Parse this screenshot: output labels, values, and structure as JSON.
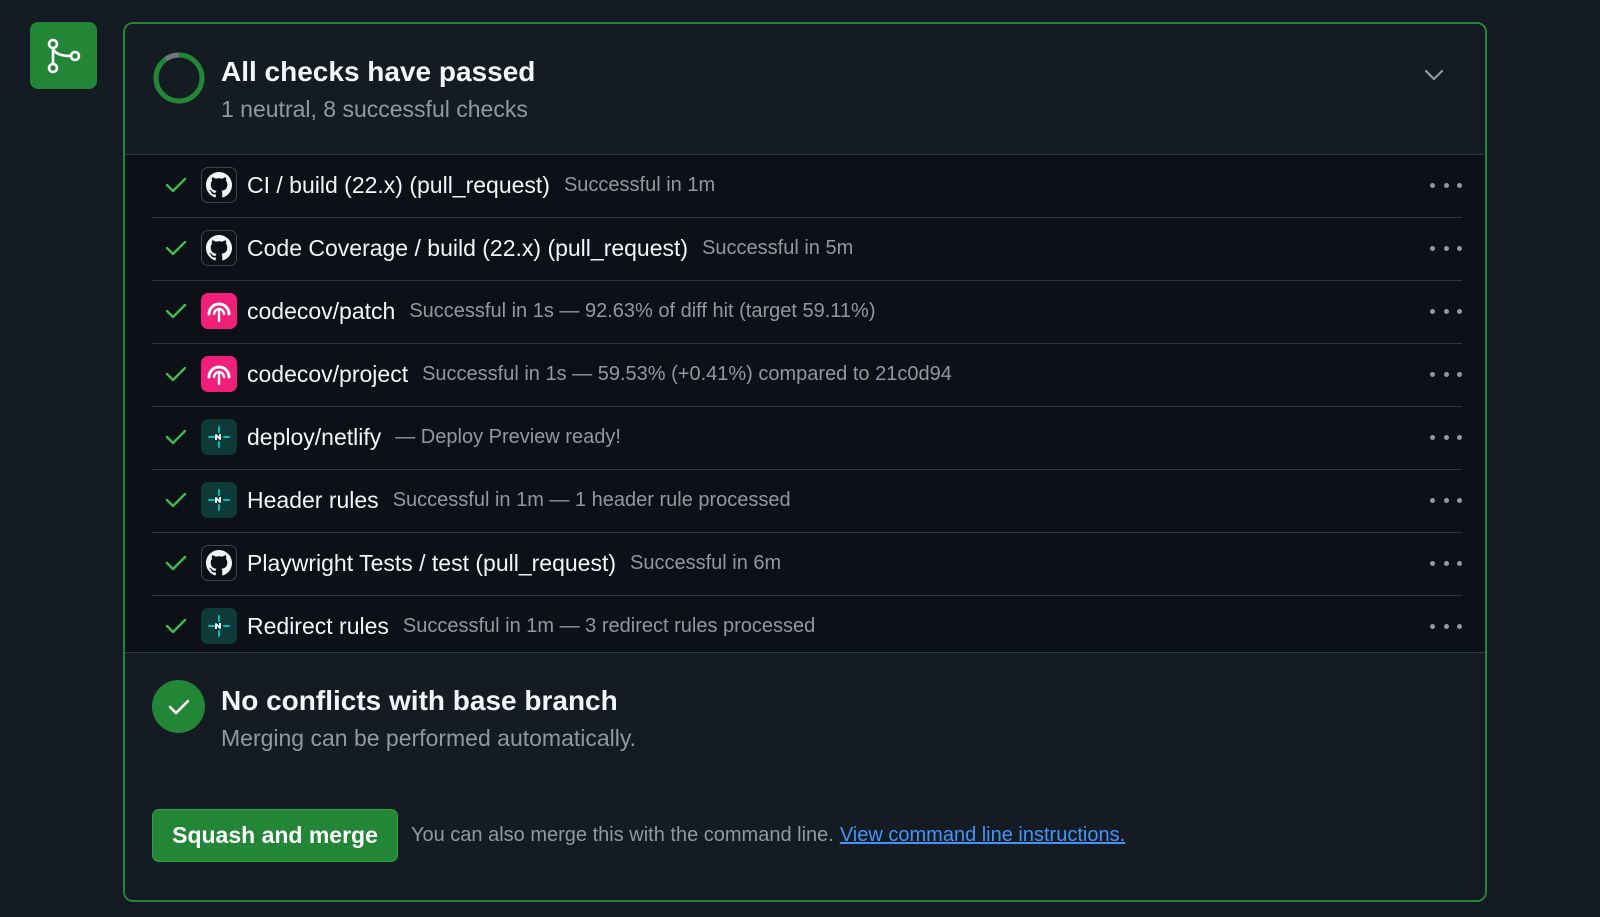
{
  "colors": {
    "accent_green": "#238636",
    "link_blue": "#4493f8",
    "codecov_pink": "#f01f7a",
    "netlify_teal": "#05bdba"
  },
  "merge_badge": {
    "icon": "git-merge-icon"
  },
  "checks_header": {
    "title": "All checks have passed",
    "subtitle": "1 neutral, 8 successful checks",
    "status_icon": "progress-ring-icon",
    "toggle_icon": "chevron-down-icon"
  },
  "checks": [
    {
      "app": "github",
      "name": "CI / build (22.x) (pull_request)",
      "description": "Successful in 1m"
    },
    {
      "app": "github",
      "name": "Code Coverage / build (22.x) (pull_request)",
      "description": "Successful in 5m"
    },
    {
      "app": "codecov",
      "name": "codecov/patch",
      "description": "Successful in 1s — 92.63% of diff hit (target 59.11%)"
    },
    {
      "app": "codecov",
      "name": "codecov/project",
      "description": "Successful in 1s — 59.53% (+0.41%) compared to 21c0d94"
    },
    {
      "app": "netlify",
      "name": "deploy/netlify",
      "description": " — Deploy Preview ready!"
    },
    {
      "app": "netlify",
      "name": "Header rules",
      "description": "Successful in 1m — 1 header rule processed"
    },
    {
      "app": "github",
      "name": "Playwright Tests / test (pull_request)",
      "description": "Successful in 6m"
    },
    {
      "app": "netlify",
      "name": "Redirect rules",
      "description": "Successful in 1m — 3 redirect rules processed"
    }
  ],
  "conflicts": {
    "title": "No conflicts with base branch",
    "subtitle": "Merging can be performed automatically."
  },
  "footer": {
    "merge_button": "Squash and merge",
    "text": "You can also merge this with the command line.",
    "link": "View command line instructions."
  }
}
